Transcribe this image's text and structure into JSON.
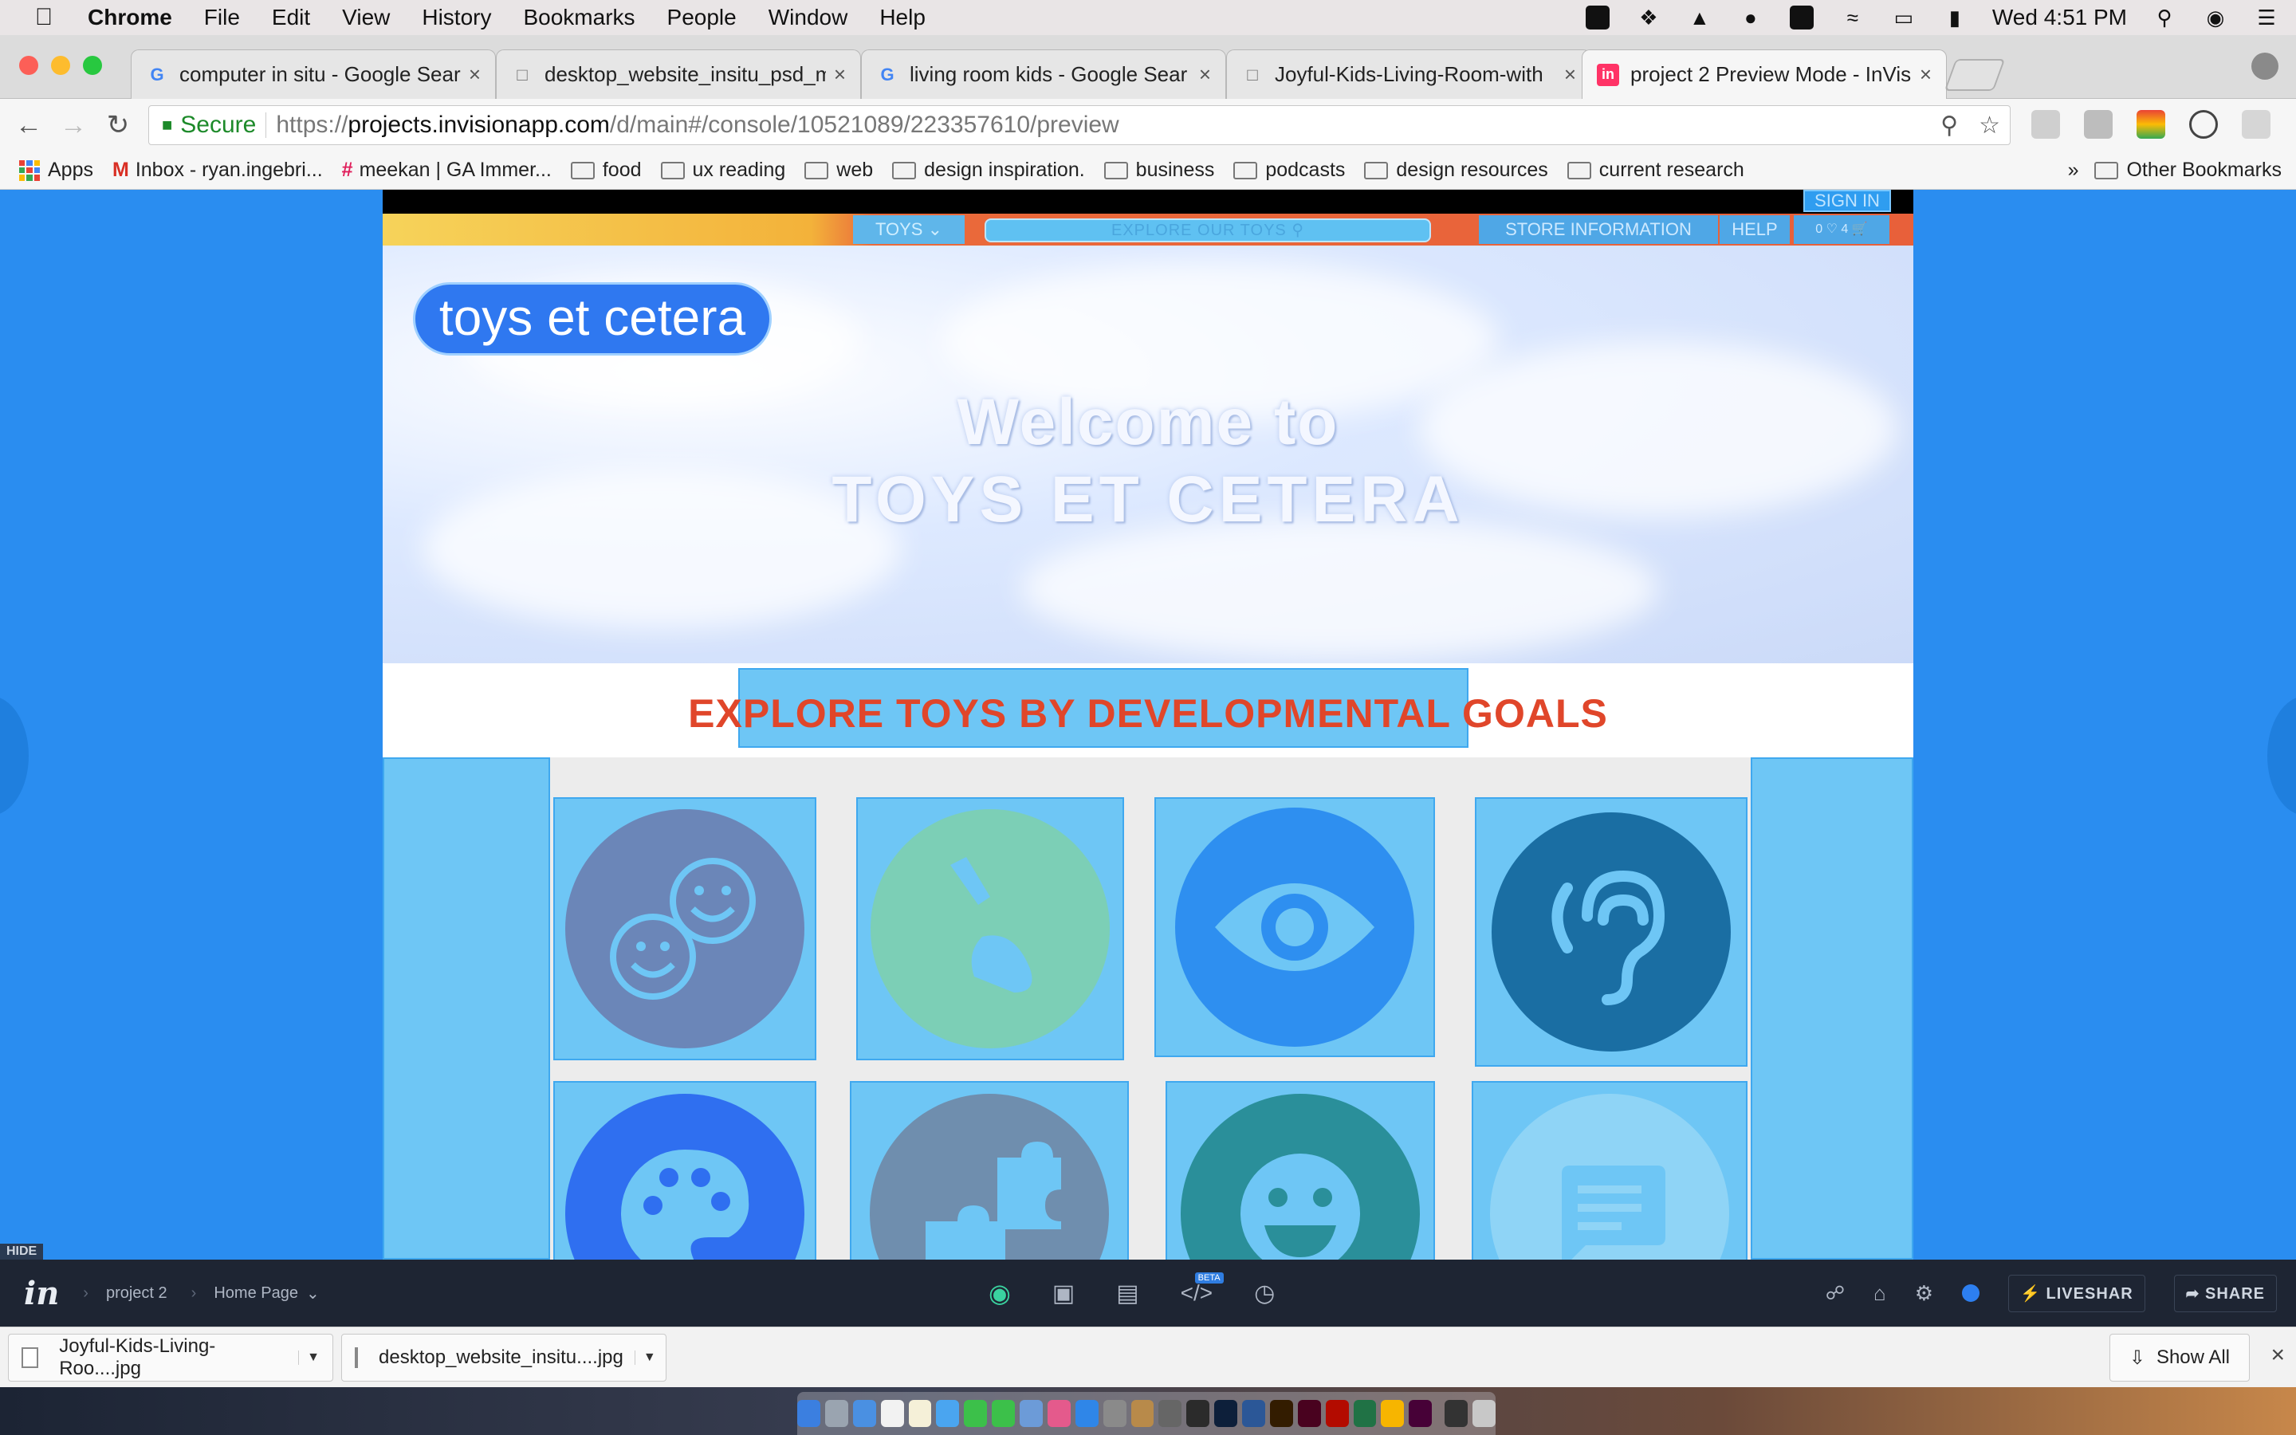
{
  "menubar": {
    "app": "Chrome",
    "items": [
      "File",
      "Edit",
      "View",
      "History",
      "Bookmarks",
      "People",
      "Window",
      "Help"
    ],
    "clock": "Wed 4:51 PM"
  },
  "tabs": [
    {
      "label": "computer in situ - Google Sear",
      "favicon": "google-icon"
    },
    {
      "label": "desktop_website_insitu_psd_m",
      "favicon": "document-icon"
    },
    {
      "label": "living room kids - Google Sear",
      "favicon": "google-icon"
    },
    {
      "label": "Joyful-Kids-Living-Room-with",
      "favicon": "document-icon"
    },
    {
      "label": "project 2 Preview Mode - InVis",
      "favicon": "invision-icon",
      "active": true
    }
  ],
  "toolbar": {
    "secure_label": "Secure",
    "url_scheme": "https://",
    "url_host": "projects.invisionapp.com",
    "url_path": "/d/main#/console/10521089/223357610/preview"
  },
  "bookmarks": {
    "items": [
      {
        "label": "Apps",
        "type": "apps"
      },
      {
        "label": "Inbox - ryan.ingebri...",
        "type": "gmail"
      },
      {
        "label": "meekan | GA Immer...",
        "type": "slack"
      },
      {
        "label": "food",
        "type": "folder"
      },
      {
        "label": "ux reading",
        "type": "folder"
      },
      {
        "label": "web",
        "type": "folder"
      },
      {
        "label": "design inspiration.",
        "type": "folder"
      },
      {
        "label": "business",
        "type": "folder"
      },
      {
        "label": "podcasts",
        "type": "folder"
      },
      {
        "label": "design resources",
        "type": "folder"
      },
      {
        "label": "current research",
        "type": "folder"
      }
    ],
    "overflow": "»",
    "other": "Other Bookmarks"
  },
  "site": {
    "sign_in": "SIGN IN",
    "nav_toys": "TOYS",
    "search_placeholder": "EXPLORE OUR TOYS",
    "store_info": "STORE INFORMATION",
    "help": "HELP",
    "cart_count": "0 ♡ 4",
    "logo": "toys et cetera",
    "hero_line1": "Welcome to",
    "hero_line2": "TOYS ET CETERA",
    "explore_heading": "EXPLORE TOYS BY DEVELOPMENTAL GOALS",
    "goal_icons": [
      {
        "icon": "emotions-icon",
        "color": "#6b86b8"
      },
      {
        "icon": "motor-skills-icon",
        "color": "#7ccfb6"
      },
      {
        "icon": "vision-icon",
        "color": "#2e8ff0"
      },
      {
        "icon": "hearing-icon",
        "color": "#1a6ea3"
      },
      {
        "icon": "art-palette-icon",
        "color": "#2f6ff0"
      },
      {
        "icon": "puzzle-icon",
        "color": "#6f8eae"
      },
      {
        "icon": "social-smile-icon",
        "color": "#2a8f9a"
      },
      {
        "icon": "language-icon",
        "color": "#8fd4f6"
      }
    ]
  },
  "invision": {
    "hide": "HIDE",
    "project": "project 2",
    "screen": "Home Page",
    "beta": "BETA",
    "liveshare": "LIVESHAR",
    "share": "SHARE"
  },
  "downloads": {
    "items": [
      "Joyful-Kids-Living-Roo....jpg",
      "desktop_website_insitu....jpg"
    ],
    "show_all": "Show All"
  }
}
